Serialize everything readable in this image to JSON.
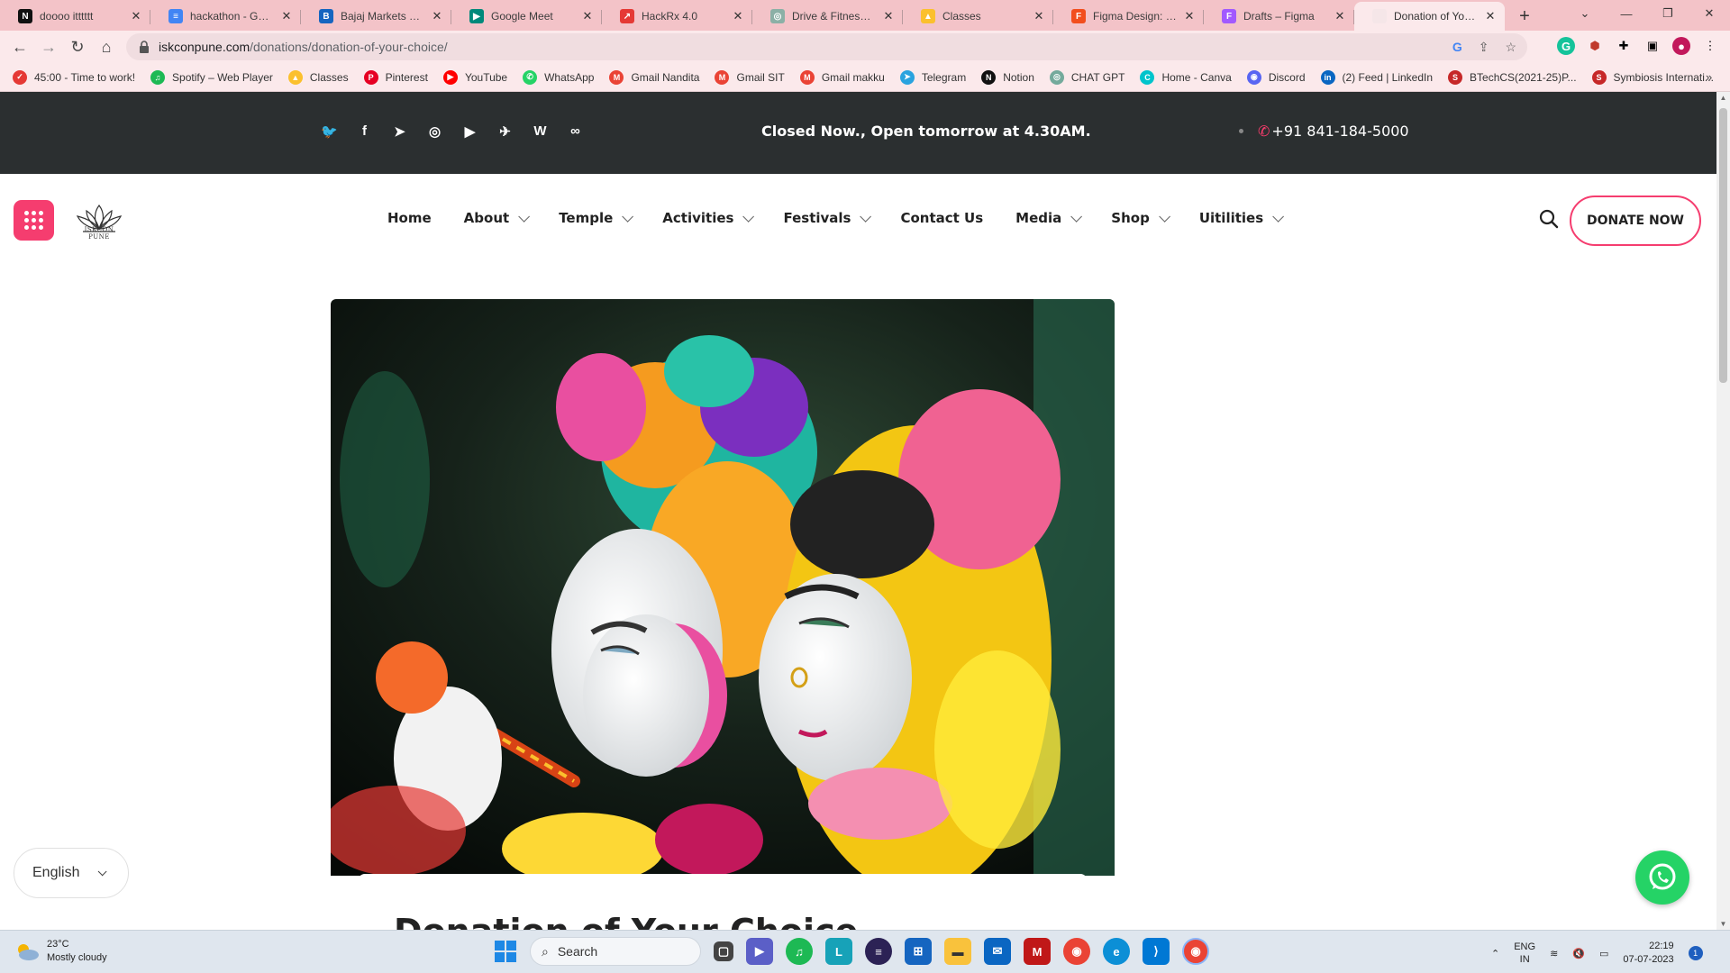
{
  "browser": {
    "tabs": [
      {
        "title": "doooo itttttt",
        "icon": "notion-icon",
        "color": "#111111",
        "glyph": "N"
      },
      {
        "title": "hackathon - Google Docs",
        "icon": "docs-icon",
        "color": "#4285f4",
        "glyph": "≡"
      },
      {
        "title": "Bajaj Markets by Bajaj",
        "icon": "bajaj-icon",
        "color": "#1565c0",
        "glyph": "B"
      },
      {
        "title": "Google Meet",
        "icon": "meet-icon",
        "color": "#00897b",
        "glyph": "▶"
      },
      {
        "title": "HackRx 4.0",
        "icon": "hackrx-icon",
        "color": "#e53935",
        "glyph": "↗"
      },
      {
        "title": "Drive & Fitness Ga",
        "icon": "globe-icon",
        "color": "#8bb0a6",
        "glyph": "◎"
      },
      {
        "title": "Classes",
        "icon": "classroom-icon",
        "color": "#fbc02d",
        "glyph": "▲"
      },
      {
        "title": "Figma Design: Isk",
        "icon": "figma-icon",
        "color": "#f24e1e",
        "glyph": "F"
      },
      {
        "title": "Drafts – Figma",
        "icon": "figma-icon",
        "color": "#a259ff",
        "glyph": "F"
      },
      {
        "title": "Donation of Your C",
        "icon": "iskcon-icon",
        "color": "#f5e6e8",
        "glyph": "",
        "active": true
      }
    ],
    "new_tab": "+",
    "address": {
      "host": "iskconpune.com",
      "path": "/donations/donation-of-your-choice/"
    },
    "bookmarks": [
      {
        "label": "45:00 - Time to work!",
        "color": "#e53935",
        "glyph": "✓"
      },
      {
        "label": "Spotify – Web Player",
        "color": "#1db954",
        "glyph": "♫"
      },
      {
        "label": "Classes",
        "color": "#fbc02d",
        "glyph": "▲"
      },
      {
        "label": "Pinterest",
        "color": "#e60023",
        "glyph": "P"
      },
      {
        "label": "YouTube",
        "color": "#ff0000",
        "glyph": "▶"
      },
      {
        "label": "WhatsApp",
        "color": "#25d366",
        "glyph": "✆"
      },
      {
        "label": "Gmail Nandita",
        "color": "#ea4335",
        "glyph": "M"
      },
      {
        "label": "Gmail SIT",
        "color": "#ea4335",
        "glyph": "M"
      },
      {
        "label": "Gmail makku",
        "color": "#ea4335",
        "glyph": "M"
      },
      {
        "label": "Telegram",
        "color": "#2aa3df",
        "glyph": "➤"
      },
      {
        "label": "Notion",
        "color": "#111111",
        "glyph": "N"
      },
      {
        "label": "CHAT GPT",
        "color": "#74aa9c",
        "glyph": "◎"
      },
      {
        "label": "Home - Canva",
        "color": "#00c4cc",
        "glyph": "C"
      },
      {
        "label": "Discord",
        "color": "#5865f2",
        "glyph": "◉"
      },
      {
        "label": "(2) Feed | LinkedIn",
        "color": "#0a66c2",
        "glyph": "in"
      },
      {
        "label": "BTechCS(2021-25)P...",
        "color": "#c62828",
        "glyph": "S"
      },
      {
        "label": "Symbiosis Internati...",
        "color": "#c62828",
        "glyph": "S"
      }
    ],
    "bookmarks_more": "»"
  },
  "site": {
    "topbar": {
      "message": "Closed Now., Open tomorrow at 4.30AM.",
      "phone": "+91 841-184-5000",
      "socials": [
        {
          "name": "twitter-icon",
          "glyph": "🐦"
        },
        {
          "name": "facebook-icon",
          "glyph": "f"
        },
        {
          "name": "location-arrow-icon",
          "glyph": "➤"
        },
        {
          "name": "instagram-icon",
          "glyph": "◎"
        },
        {
          "name": "youtube-icon",
          "glyph": "▶"
        },
        {
          "name": "telegram-icon",
          "glyph": "✈"
        },
        {
          "name": "wordpress-icon",
          "glyph": "W"
        },
        {
          "name": "tripadvisor-icon",
          "glyph": "∞"
        }
      ],
      "accent": "#ff3d6e",
      "background": "#2b2f30"
    },
    "logo_text": "ISKCON PUNE",
    "nav": [
      {
        "label": "Home",
        "dropdown": false
      },
      {
        "label": "About",
        "dropdown": true
      },
      {
        "label": "Temple",
        "dropdown": true
      },
      {
        "label": "Activities",
        "dropdown": true
      },
      {
        "label": "Festivals",
        "dropdown": true
      },
      {
        "label": "Contact Us",
        "dropdown": false
      },
      {
        "label": "Media",
        "dropdown": true
      },
      {
        "label": "Shop",
        "dropdown": true
      },
      {
        "label": "Uitilities",
        "dropdown": true
      }
    ],
    "donate_label": "DONATE NOW",
    "brand_color": "#f53d6f",
    "page_title": "Donation of Your Choice",
    "language": "English"
  },
  "taskbar": {
    "weather_temp": "23°C",
    "weather_desc": "Mostly cloudy",
    "search_placeholder": "Search",
    "lang_top": "ENG",
    "lang_bottom": "IN",
    "time": "22:19",
    "date": "07-07-2023",
    "notifications": "1"
  }
}
